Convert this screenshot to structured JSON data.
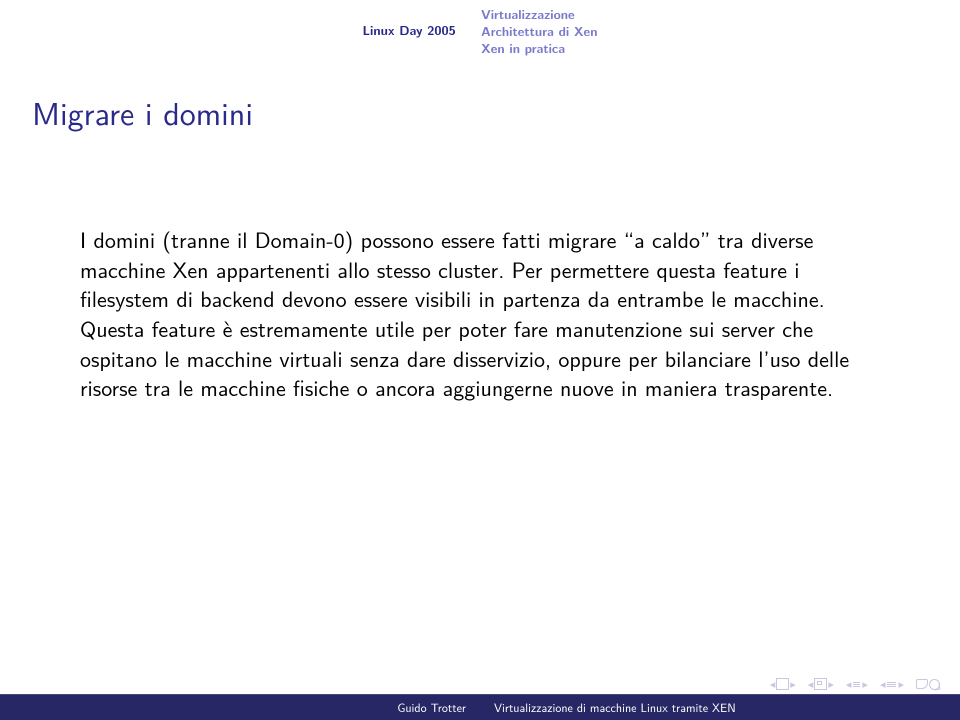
{
  "header": {
    "left": "Linux Day 2005",
    "right": {
      "l1": "Virtualizzazione",
      "l2": "Architettura di Xen",
      "l3": "Xen in pratica"
    }
  },
  "title": "Migrare i domini",
  "body": "I domini (tranne il Domain-0) possono essere fatti migrare “a caldo” tra diverse macchine Xen appartenenti allo stesso cluster. Per permettere questa feature i filesystem di backend devono essere visibili in partenza da entrambe le macchine. Questa feature è estremamente utile per poter fare manutenzione sui server che ospitano le macchine virtuali senza dare disservizio, oppure per bilanciare l’uso delle risorse tra le macchine fisiche o ancora aggiungerne nuove in maniera trasparente.",
  "footer": {
    "author": "Guido Trotter",
    "talk": "Virtualizzazione di macchine Linux tramite XEN"
  },
  "nav": {
    "prev": "◂",
    "next": "▸"
  }
}
